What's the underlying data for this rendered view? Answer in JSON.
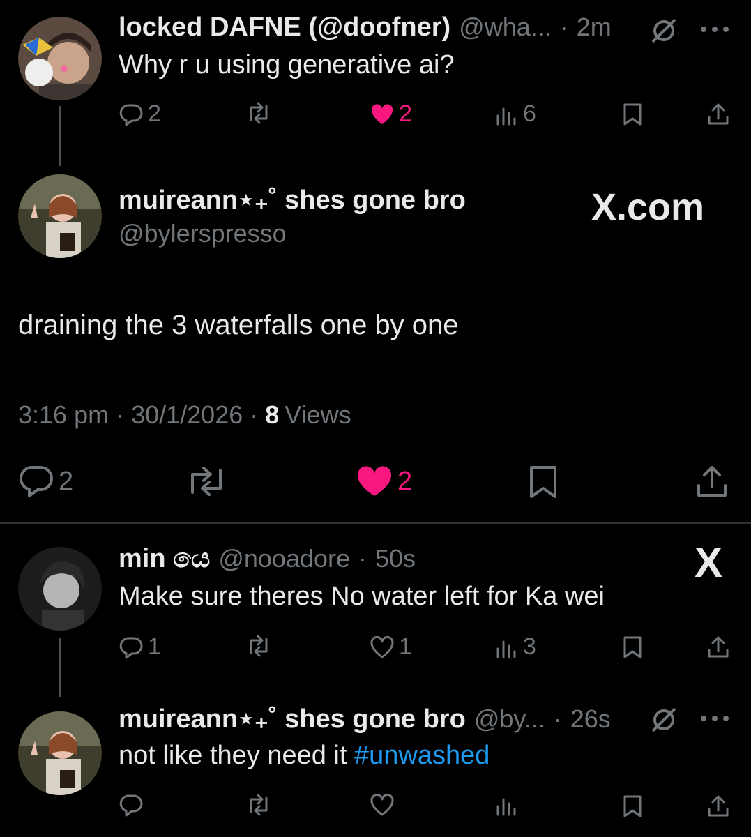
{
  "reply1": {
    "display_name": "locked DAFNE (@doofner)",
    "handle": "@wha...",
    "time": "2m",
    "text": "Why r u using generative ai?",
    "replies": "2",
    "likes": "2",
    "views": "6"
  },
  "main_post": {
    "display_name": "muireann⋆₊˚ shes gone bro",
    "handle": "@bylerspresso",
    "watermark": "X.com",
    "text": "draining the 3 waterfalls one by one",
    "time": "3:16 pm",
    "date": "30/1/2026",
    "views_count": "8",
    "views_label": "Views",
    "replies": "2",
    "likes": "2"
  },
  "reply2": {
    "display_name": "min යෙ",
    "handle": "@nooadore",
    "time": "50s",
    "watermark": "X",
    "text": "Make sure theres No water left for Ka wei",
    "replies": "1",
    "likes": "1",
    "views": "3"
  },
  "reply3": {
    "display_name": "muireann⋆₊˚ shes gone bro",
    "handle": "@by...",
    "time": "26s",
    "text": "not like they need it",
    "hashtag": "#unwashed"
  },
  "colors": {
    "background": "#000000",
    "muted": "#71767b",
    "like": "#f91880",
    "link": "#1d9bf0"
  }
}
